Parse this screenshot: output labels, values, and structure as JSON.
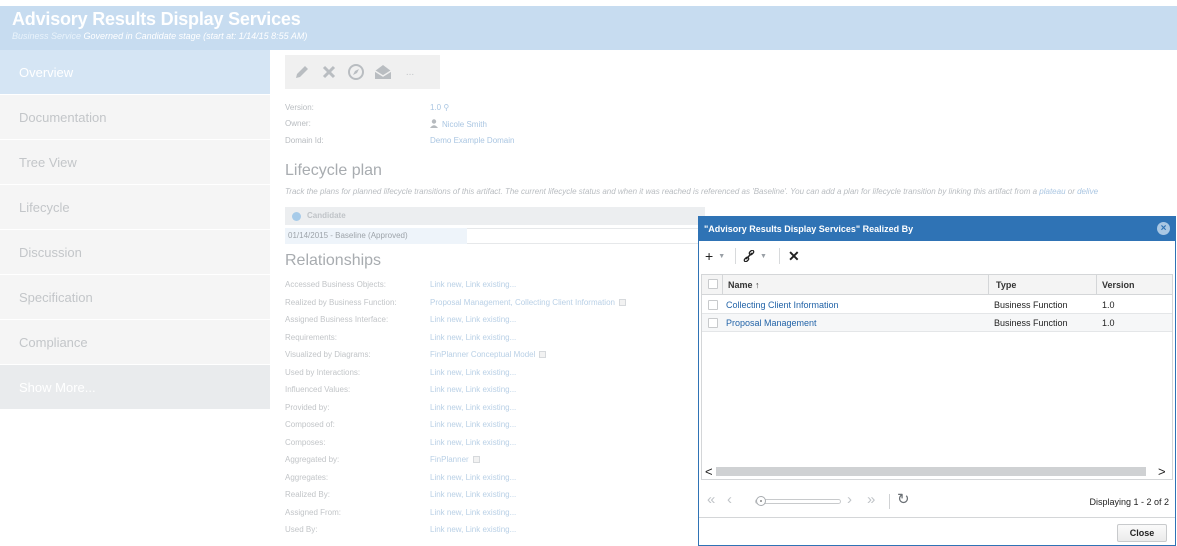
{
  "header": {
    "title": "Advisory Results Display Services",
    "subtitle_type": "Business Service",
    "subtitle_rest": "Governed in Candidate stage (start at: 1/14/15 8:55 AM)"
  },
  "sidebar": {
    "items": [
      {
        "label": "Overview"
      },
      {
        "label": "Documentation"
      },
      {
        "label": "Tree View"
      },
      {
        "label": "Lifecycle"
      },
      {
        "label": "Discussion"
      },
      {
        "label": "Specification"
      },
      {
        "label": "Compliance"
      },
      {
        "label": "Show More..."
      }
    ]
  },
  "toolbar": {
    "icons": [
      "pencil-icon",
      "delete-x-icon",
      "compass-icon",
      "mail-icon",
      "more-icon"
    ],
    "more_label": "..."
  },
  "properties": {
    "version_label": "Version:",
    "version_value": "1.0",
    "owner_label": "Owner:",
    "owner_value": "Nicole Smith",
    "domain_label": "Domain Id:",
    "domain_value": "Demo Example Domain"
  },
  "lifecycle": {
    "heading": "Lifecycle plan",
    "description": "Track the plans for planned lifecycle transitions of this artifact. The current lifecycle status and when it was reached is referenced as 'Baseline'. You can add a plan for lifecycle transition by linking this artifact from a",
    "link_plateau": "plateau",
    "or_text": "or",
    "link_deliv": "delive",
    "candidate": "Candidate",
    "baseline": "01/14/2015 - Baseline (Approved)"
  },
  "relationships": {
    "heading": "Relationships",
    "rows": [
      {
        "label": "Accessed Business Objects:",
        "value": "Link new, Link existing..."
      },
      {
        "label": "Realized by Business Function:",
        "value": "Proposal Management, Collecting Client Information"
      },
      {
        "label": "Assigned Business Interface:",
        "value": "Link new, Link existing..."
      },
      {
        "label": "Requirements:",
        "value": "Link new, Link existing..."
      },
      {
        "label": "Visualized by Diagrams:",
        "value": "FinPlanner Conceptual Model"
      },
      {
        "label": "Used by Interactions:",
        "value": "Link new, Link existing..."
      },
      {
        "label": "Influenced Values:",
        "value": "Link new, Link existing..."
      },
      {
        "label": "Provided by:",
        "value": "Link new, Link existing..."
      },
      {
        "label": "Composed of:",
        "value": "Link new, Link existing..."
      },
      {
        "label": "Composes:",
        "value": "Link new, Link existing..."
      },
      {
        "label": "Aggregated by:",
        "value": "FinPlanner"
      },
      {
        "label": "Aggregates:",
        "value": "Link new, Link existing..."
      },
      {
        "label": "Realized By:",
        "value": "Link new, Link existing..."
      },
      {
        "label": "Assigned From:",
        "value": "Link new, Link existing..."
      },
      {
        "label": "Used By:",
        "value": "Link new, Link existing..."
      }
    ]
  },
  "dialog": {
    "title": "\"Advisory Results Display Services\" Realized By",
    "columns": {
      "name": "Name ↑",
      "type": "Type",
      "version": "Version"
    },
    "rows": [
      {
        "name": "Collecting Client Information",
        "type": "Business Function",
        "version": "1.0"
      },
      {
        "name": "Proposal Management",
        "type": "Business Function",
        "version": "1.0"
      }
    ],
    "paging_info": "Displaying 1 - 2 of 2",
    "close_label": "Close"
  }
}
